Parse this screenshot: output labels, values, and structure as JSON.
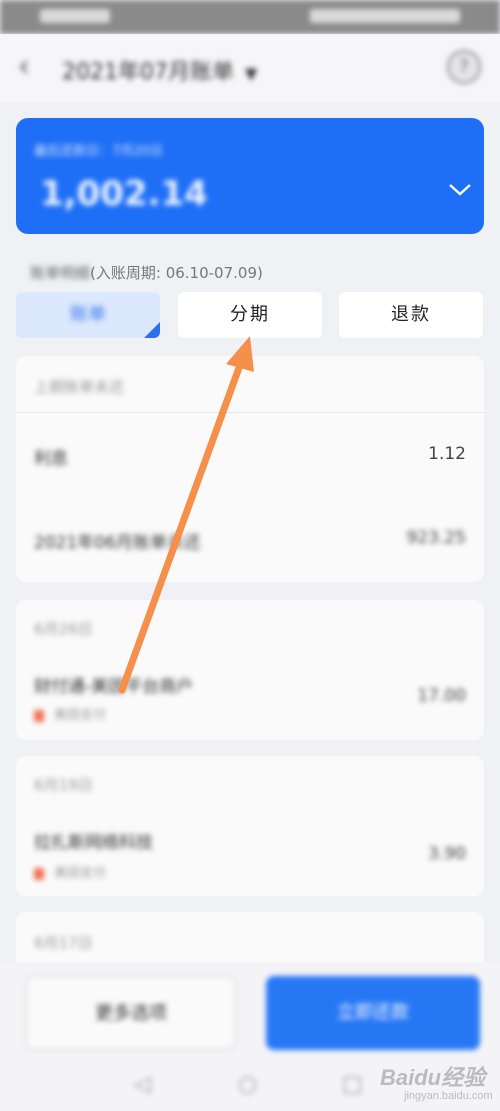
{
  "status_bar": {
    "left": "",
    "right": ""
  },
  "header": {
    "title": "2021年07月账单",
    "dropdown_icon": "caret-down-icon",
    "back_icon": "chevron-left-icon",
    "help_icon": "question-icon",
    "help_glyph": "?"
  },
  "card": {
    "due_text": "最后还款日：7月20日",
    "amount": "1,002.14",
    "chevron": "chevron-down-icon"
  },
  "bill_details": {
    "label": "账单明细",
    "period": "(入账周期: 06.10-07.09)"
  },
  "tabs": {
    "bill": "账单",
    "installment": "分期",
    "refund": "退款"
  },
  "section1": {
    "header": "上期账单未还",
    "rows": [
      {
        "label": "利息",
        "amount": "1.12"
      },
      {
        "label": "2021年06月账单未还",
        "amount": "923.25"
      }
    ]
  },
  "section2": {
    "header": "6月26日",
    "rows": [
      {
        "label": "财付通-美团平台商户",
        "sub": "美团支付",
        "amount": "17.00"
      }
    ]
  },
  "section3": {
    "header": "6月19日",
    "rows": [
      {
        "label": "拉扎斯网络科技",
        "sub": "美团支付",
        "amount": "3.90"
      }
    ]
  },
  "section4": {
    "header": "6月17日"
  },
  "bottom": {
    "more_label": "更多选项",
    "repay_label": "立即还款"
  },
  "nav": {
    "back": "◁",
    "home": "○",
    "recent": "□"
  },
  "watermark": {
    "brand": "Baidu经验",
    "sub": "jingyan.baidu.com"
  },
  "colors": {
    "accent": "#1f6ff6",
    "arrow": "#f5904a"
  }
}
